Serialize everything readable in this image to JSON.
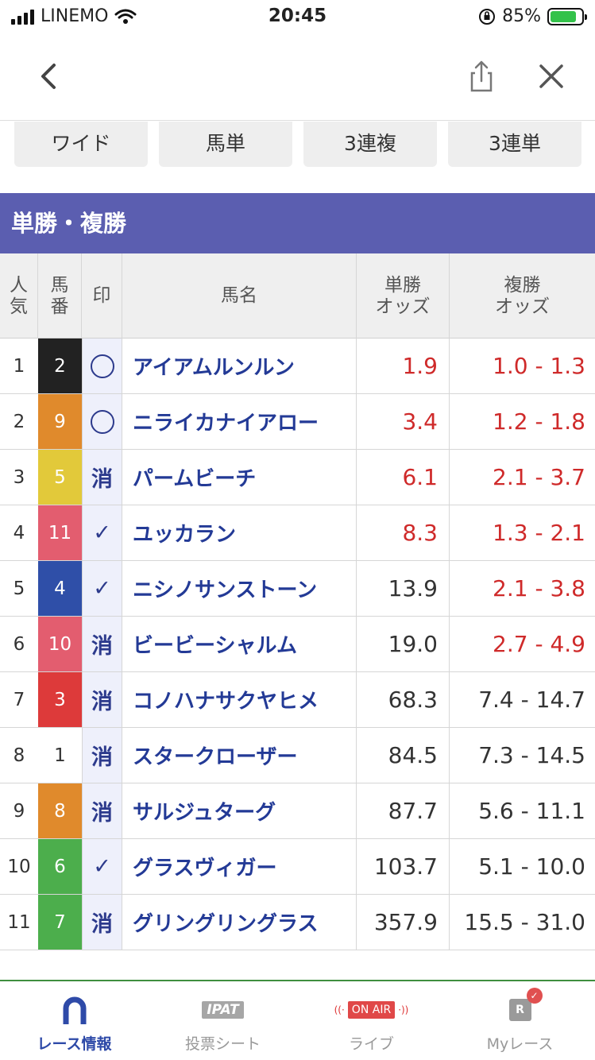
{
  "status_bar": {
    "carrier": "LINEMO",
    "time": "20:45",
    "battery": "85%",
    "battery_level": 0.85
  },
  "nav": {
    "back_icon": "chevron-left-icon",
    "share_icon": "share-icon",
    "close_icon": "close-icon"
  },
  "tabs": [
    "ワイド",
    "馬単",
    "3連複",
    "3連単"
  ],
  "section_title": "単勝・複勝",
  "table": {
    "headers": {
      "rank": [
        "人",
        "気"
      ],
      "number": [
        "馬",
        "番"
      ],
      "mark": "印",
      "name": "馬名",
      "win": [
        "単勝",
        "オッズ"
      ],
      "place": [
        "複勝",
        "オッズ"
      ]
    },
    "rows": [
      {
        "rank": "1",
        "num": "2",
        "num_bg": "#222222",
        "num_color": "#ffffff",
        "mark": "○",
        "name": "アイアムルンルン",
        "win": "1.9",
        "win_hot": true,
        "place": "1.0 - 1.3",
        "place_hot": true
      },
      {
        "rank": "2",
        "num": "9",
        "num_bg": "#e08a2c",
        "num_color": "#ffffff",
        "mark": "○",
        "name": "ニライカナイアロー",
        "win": "3.4",
        "win_hot": true,
        "place": "1.2 - 1.8",
        "place_hot": true
      },
      {
        "rank": "3",
        "num": "5",
        "num_bg": "#e2c93a",
        "num_color": "#ffffff",
        "mark": "消",
        "name": "パームビーチ",
        "win": "6.1",
        "win_hot": true,
        "place": "2.1 - 3.7",
        "place_hot": true
      },
      {
        "rank": "4",
        "num": "11",
        "num_bg": "#e35d6f",
        "num_color": "#ffffff",
        "mark": "✓",
        "name": "ユッカラン",
        "win": "8.3",
        "win_hot": true,
        "place": "1.3 - 2.1",
        "place_hot": true
      },
      {
        "rank": "5",
        "num": "4",
        "num_bg": "#2f4fa8",
        "num_color": "#ffffff",
        "mark": "✓",
        "name": "ニシノサンストーン",
        "win": "13.9",
        "win_hot": false,
        "place": "2.1 - 3.8",
        "place_hot": true
      },
      {
        "rank": "6",
        "num": "10",
        "num_bg": "#e35d6f",
        "num_color": "#ffffff",
        "mark": "消",
        "name": "ビービーシャルム",
        "win": "19.0",
        "win_hot": false,
        "place": "2.7 - 4.9",
        "place_hot": true
      },
      {
        "rank": "7",
        "num": "3",
        "num_bg": "#dd3a3a",
        "num_color": "#ffffff",
        "mark": "消",
        "name": "コノハナサクヤヒメ",
        "win": "68.3",
        "win_hot": false,
        "place": "7.4 - 14.7",
        "place_hot": false
      },
      {
        "rank": "8",
        "num": "1",
        "num_bg": "#ffffff",
        "num_color": "#333333",
        "mark": "消",
        "name": "スタークローザー",
        "win": "84.5",
        "win_hot": false,
        "place": "7.3 - 14.5",
        "place_hot": false
      },
      {
        "rank": "9",
        "num": "8",
        "num_bg": "#e08a2c",
        "num_color": "#ffffff",
        "mark": "消",
        "name": "サルジュターグ",
        "win": "87.7",
        "win_hot": false,
        "place": "5.6 - 11.1",
        "place_hot": false
      },
      {
        "rank": "10",
        "num": "6",
        "num_bg": "#4cae4c",
        "num_color": "#ffffff",
        "mark": "✓",
        "name": "グラスヴィガー",
        "win": "103.7",
        "win_hot": false,
        "place": "5.1 - 10.0",
        "place_hot": false
      },
      {
        "rank": "11",
        "num": "7",
        "num_bg": "#4cae4c",
        "num_color": "#ffffff",
        "mark": "消",
        "name": "グリングリングラス",
        "win": "357.9",
        "win_hot": false,
        "place": "15.5 - 31.0",
        "place_hot": false
      }
    ]
  },
  "bottom_nav": [
    {
      "label": "レース情報",
      "icon": "horseshoe-icon",
      "active": true
    },
    {
      "label": "投票シート",
      "icon": "ipat-icon",
      "icon_text": "IPAT",
      "active": false
    },
    {
      "label": "ライブ",
      "icon": "on-air-icon",
      "icon_text": "ON AIR",
      "active": false
    },
    {
      "label": "Myレース",
      "icon": "my-race-icon",
      "icon_text": "R",
      "active": false
    }
  ],
  "colors": {
    "header_bg": "#5b5eb0",
    "accent_blue": "#233a96",
    "odds_red": "#cf2a2a",
    "mark_bg": "#eef0fb"
  }
}
